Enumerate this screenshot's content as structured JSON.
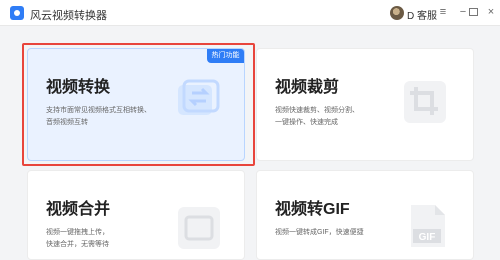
{
  "app": {
    "title": "风云视频转换器",
    "user": "D 客服"
  },
  "window": {
    "menu_icon": "menu-icon",
    "minimize_icon": "minimize-icon",
    "maximize_icon": "maximize-icon",
    "close_icon": "close-icon"
  },
  "cards": [
    {
      "title": "视频转换",
      "desc_lines": [
        "支持市面常见视频格式互相转换、",
        "音频视频互转"
      ],
      "badge": "热门功能",
      "icon": "video-convert-icon",
      "selected": true
    },
    {
      "title": "视频裁剪",
      "desc_lines": [
        "视频快速裁剪、视频分割、",
        "一键操作、快速完成"
      ],
      "icon": "crop-icon",
      "selected": false
    },
    {
      "title": "视频合并",
      "desc_lines": [
        "视频一键拖拽上传，",
        "快速合并，无需等待"
      ],
      "icon": "merge-icon",
      "selected": false
    },
    {
      "title": "视频转GIF",
      "desc_lines": [
        "视频一键转成GIF，快速便捷"
      ],
      "icon": "gif-file-icon",
      "gif_label": "GIF",
      "selected": false
    }
  ],
  "colors": {
    "accent": "#2f7df6",
    "selected_bg": "#eaf2ff",
    "highlight": "#e8453c"
  }
}
